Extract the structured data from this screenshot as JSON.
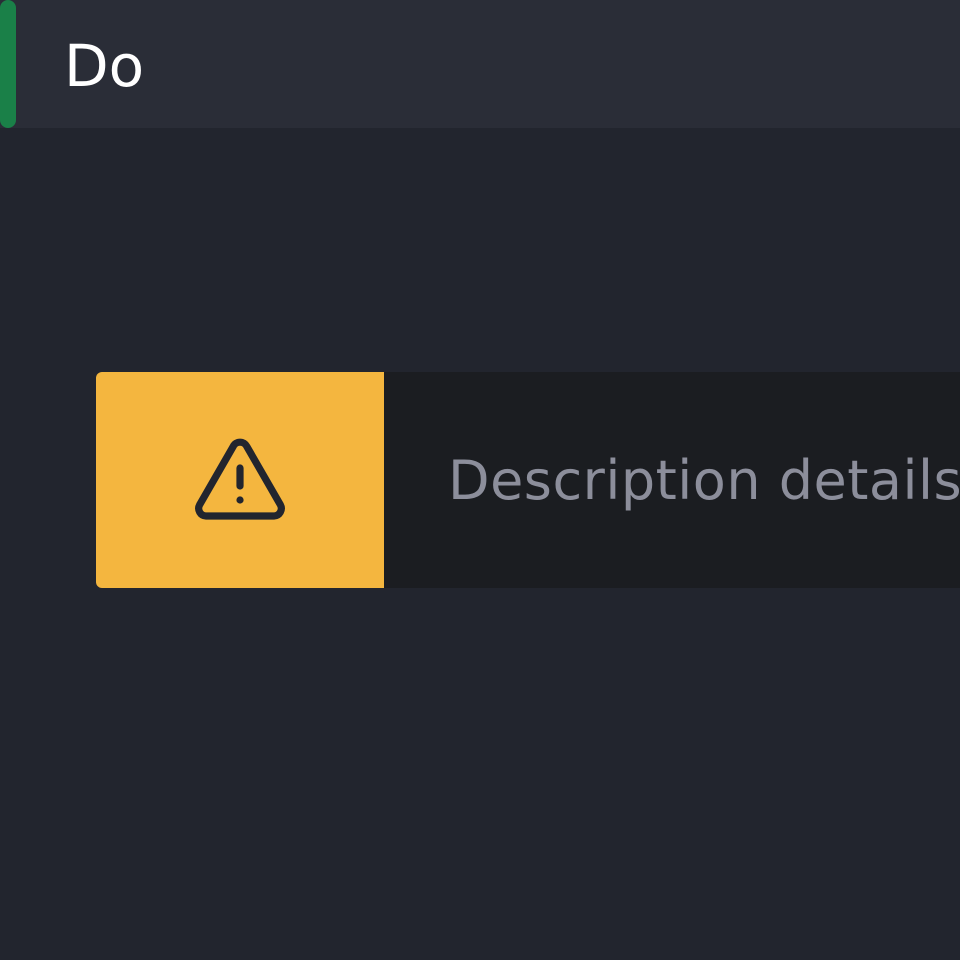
{
  "header": {
    "title": "Do",
    "accent_color": "#1a8048"
  },
  "alert": {
    "icon": "warning-triangle-icon",
    "icon_background": "#f4b63f",
    "description": "Description details"
  }
}
